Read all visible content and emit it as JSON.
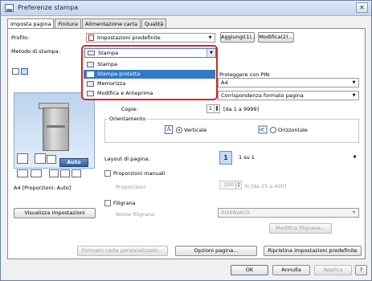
{
  "window": {
    "title": "Preferenze stampa",
    "close_glyph": "✕"
  },
  "tabs": [
    {
      "label": "Imposta pagina",
      "active": true
    },
    {
      "label": "Finitura",
      "active": false
    },
    {
      "label": "Alimentazione carta",
      "active": false
    },
    {
      "label": "Qualità",
      "active": false
    }
  ],
  "profile": {
    "label": "Profilo:",
    "value": "Impostazioni predefinite",
    "add_button": "Aggiungi(1)...",
    "edit_button": "Modifica(2)..."
  },
  "print_method": {
    "label": "Metodo di stampa:",
    "value": "Stampa",
    "options": [
      "Stampa",
      "Stampa protetta",
      "Memorizza",
      "Modifica e Anteprima"
    ],
    "selected_option": "Stampa protetta"
  },
  "page_size": {
    "header_partial": "Proteggere con PIN",
    "value": "A4"
  },
  "output_size": {
    "value": "Corrispondenza formato pagina"
  },
  "copies": {
    "label": "Copie:",
    "value": "1",
    "range": "[da 1 a 9999]"
  },
  "orientation": {
    "label": "Orientamento",
    "portrait_label": "Verticale",
    "landscape_label": "Orizzontale",
    "selected": "Verticale"
  },
  "page_layout": {
    "label": "Layout di pagina:",
    "value": "1 su 1",
    "icon_text": "1"
  },
  "manual_scaling": {
    "label": "Proporzioni manuali",
    "sub_label": "Proporzioni:",
    "value": "100",
    "range": "% [da 25 a 400]",
    "checked": false
  },
  "watermark": {
    "label": "Filigrana",
    "name_label": "Nome filigrana:",
    "value": "RISERVATO",
    "edit_button": "Modifica filigrana...",
    "checked": false
  },
  "preview": {
    "auto_label": "Auto",
    "status_text": "A4 [Proporzioni: Auto]",
    "view_settings_button": "Visualizza impostazioni"
  },
  "bottom_buttons": {
    "custom_paper": "Formato carta personalizzato...",
    "page_options": "Opzioni pagina...",
    "restore_defaults": "Ripristina impostazioni predefinite"
  },
  "dialog_buttons": {
    "ok": "OK",
    "cancel": "Annulla",
    "apply": "Applica",
    "help": "?"
  },
  "colors": {
    "accent": "#3379c6",
    "highlight_ring": "#d32626",
    "preview_bg": "#bcd3ee"
  }
}
